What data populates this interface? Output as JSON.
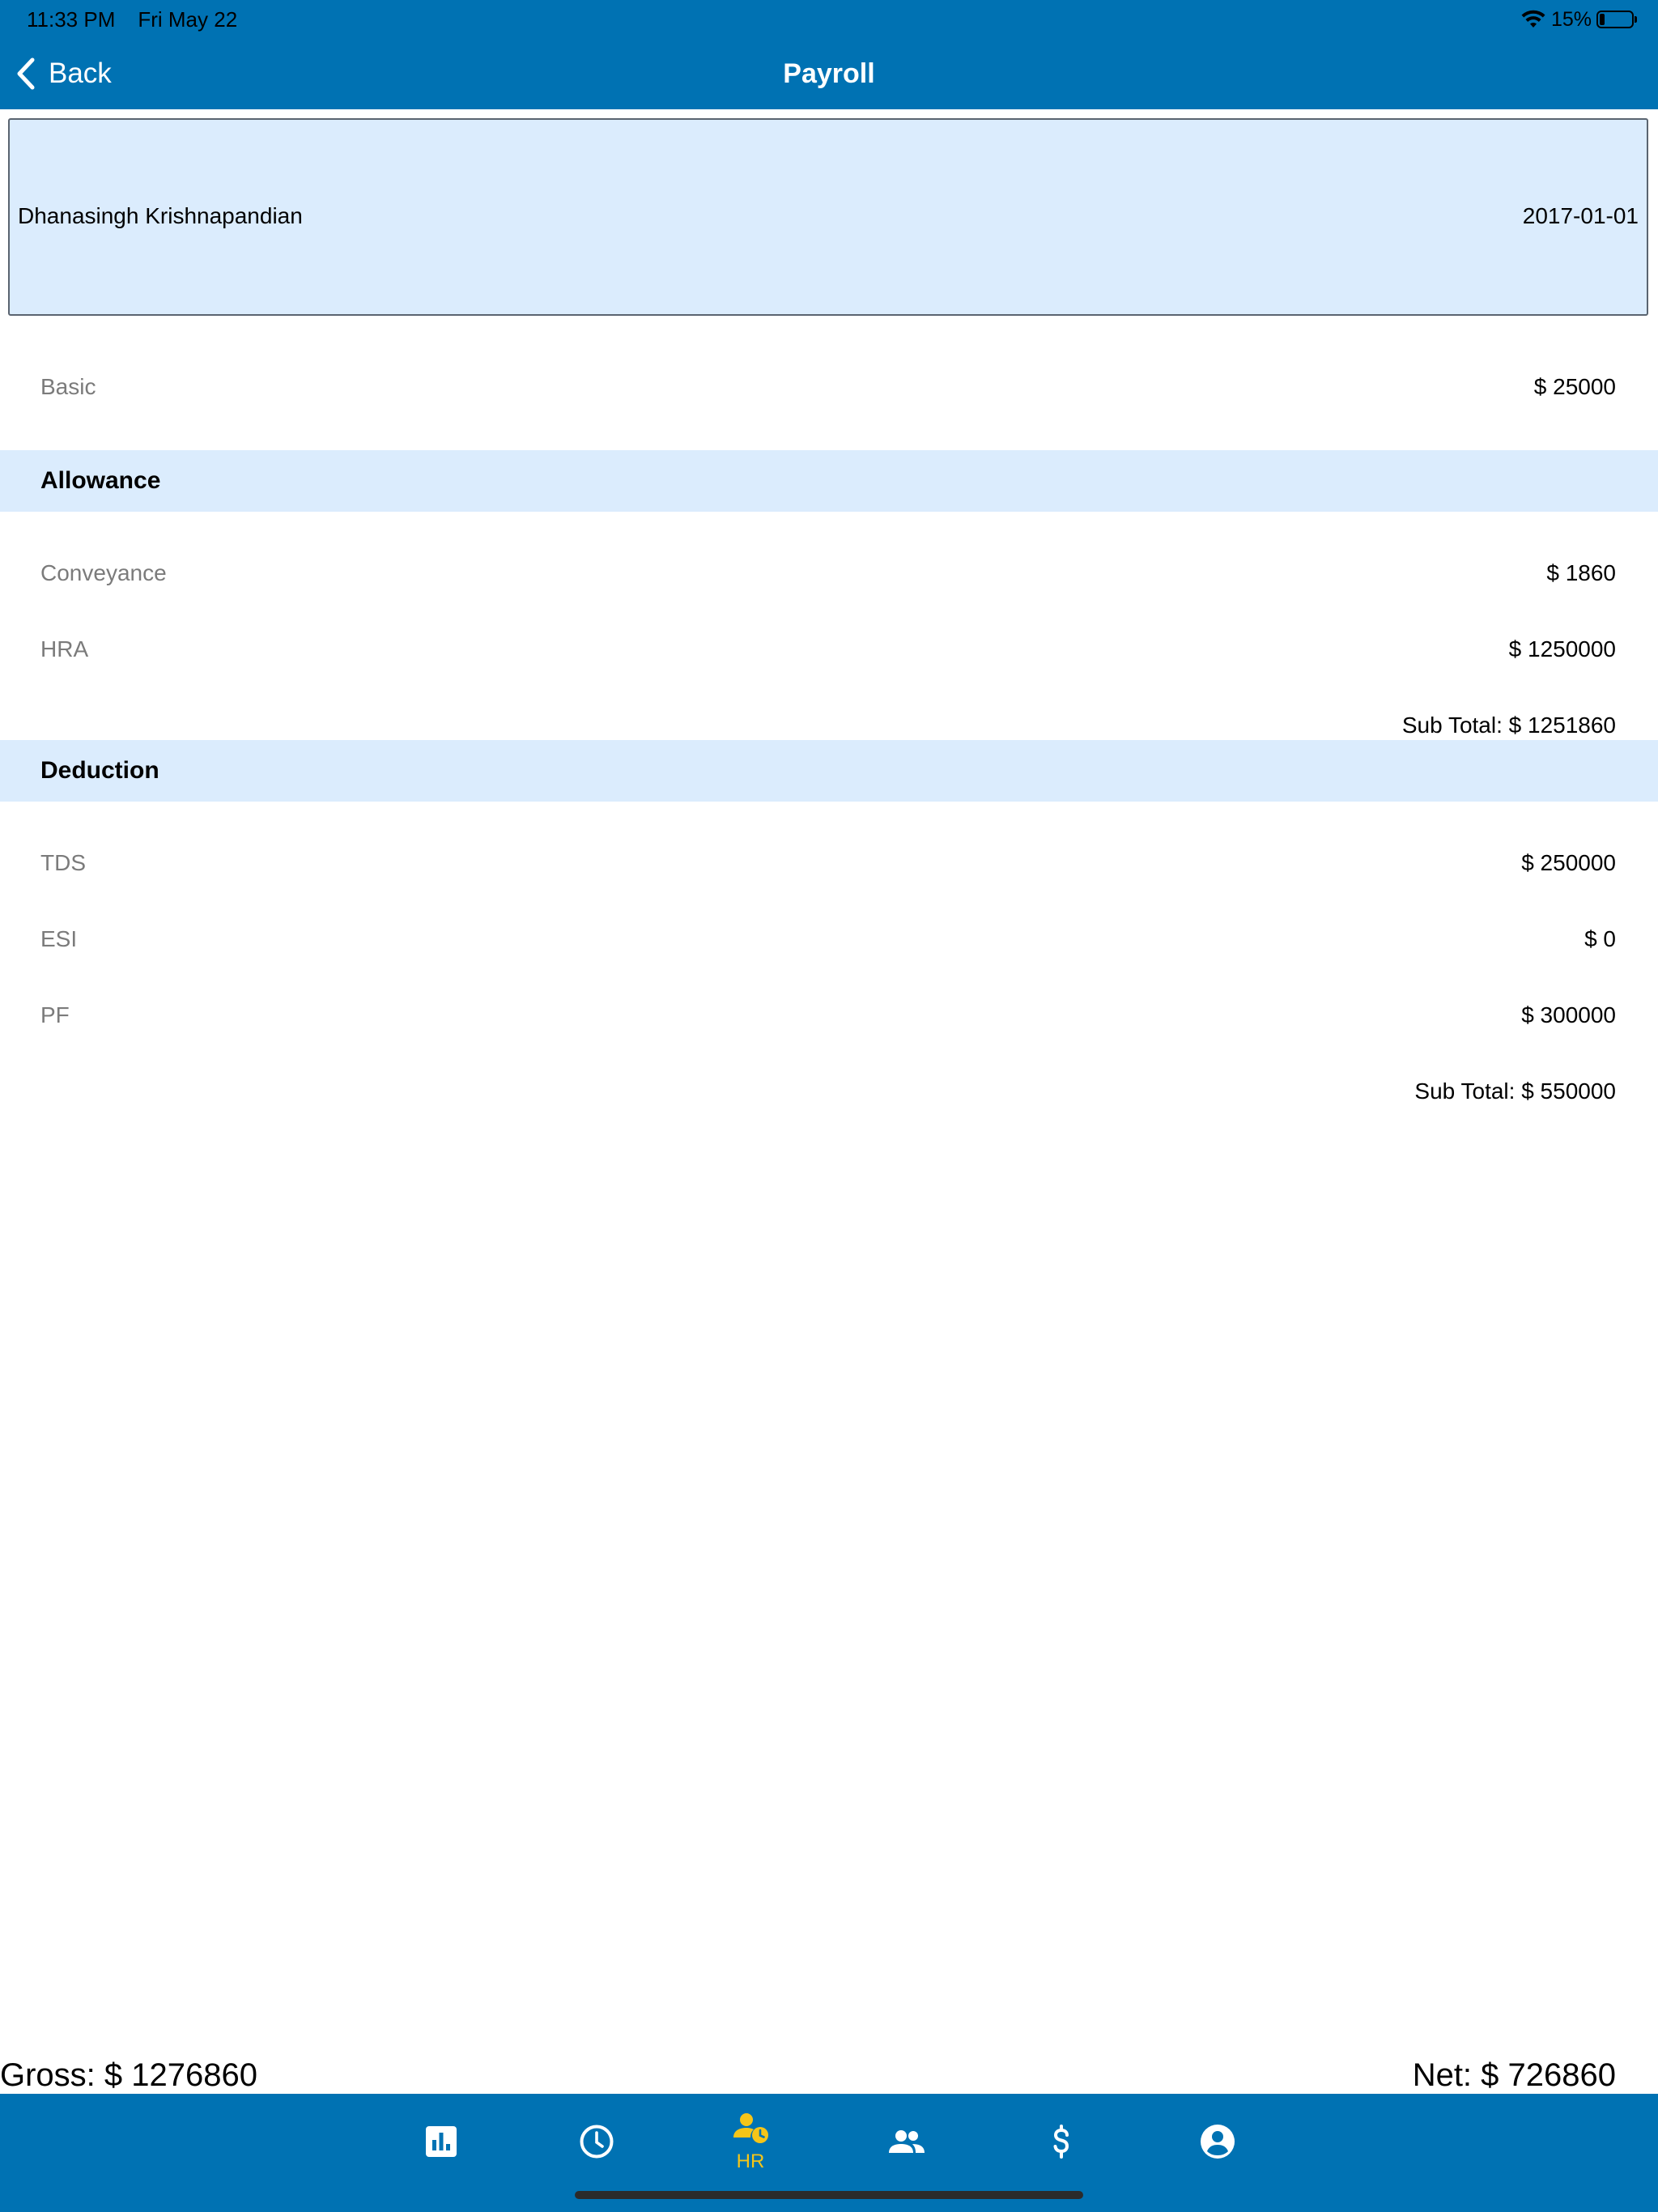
{
  "status_bar": {
    "time": "11:33 PM",
    "date": "Fri May 22",
    "battery": "15%"
  },
  "nav": {
    "back_label": "Back",
    "title": "Payroll"
  },
  "employee": {
    "name": "Dhanasingh Krishnapandian",
    "date": "2017-01-01"
  },
  "basic": {
    "label": "Basic",
    "value": "$ 25000"
  },
  "allowance": {
    "title": "Allowance",
    "items": [
      {
        "label": "Conveyance",
        "value": "$ 1860"
      },
      {
        "label": "HRA",
        "value": "$ 1250000"
      }
    ],
    "subtotal": "Sub Total: $ 1251860"
  },
  "deduction": {
    "title": "Deduction",
    "items": [
      {
        "label": "TDS",
        "value": "$ 250000"
      },
      {
        "label": "ESI",
        "value": "$ 0"
      },
      {
        "label": "PF",
        "value": "$ 300000"
      }
    ],
    "subtotal": "Sub Total: $ 550000"
  },
  "totals": {
    "gross": "Gross: $ 1276860",
    "net": "Net: $ 726860"
  },
  "tab_bar": {
    "tabs": [
      {
        "icon": "bar-chart-icon",
        "label": ""
      },
      {
        "icon": "clock-icon",
        "label": ""
      },
      {
        "icon": "person-clock-icon",
        "label": "HR",
        "active": true
      },
      {
        "icon": "people-icon",
        "label": ""
      },
      {
        "icon": "dollar-icon",
        "label": ""
      },
      {
        "icon": "account-circle-icon",
        "label": ""
      }
    ]
  },
  "colors": {
    "primary": "#0072b3",
    "section_bg": "#dbecfd",
    "active_tab": "#f5c518",
    "label_gray": "#7b7b7b"
  }
}
